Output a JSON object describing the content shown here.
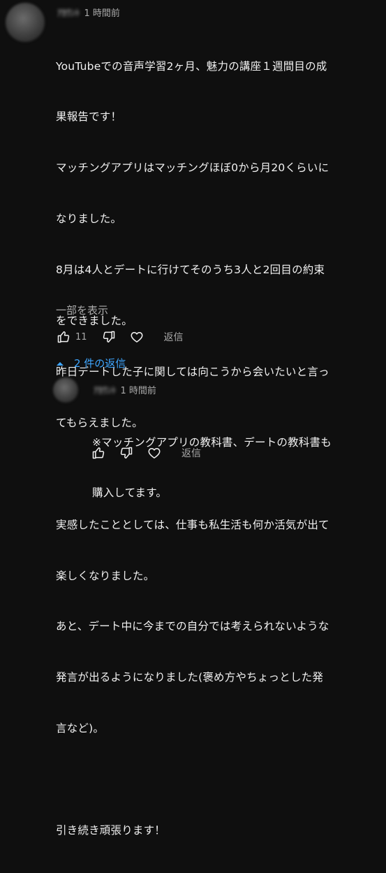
{
  "comment": {
    "author": "ｱｶｳﾝﾄ",
    "time": "1 時間前",
    "lines": [
      "YouTubeでの音声学習2ヶ月、魅力の講座１週間目の成",
      "果報告です！",
      "マッチングアプリはマッチングほぼ0から月20くらいに",
      "なりました。",
      "8月は4人とデートに行けてそのうち3人と2回目の約束",
      "をできました。",
      "昨日デートした子に関しては向こうから会いたいと言っ",
      "てもらえました。",
      "",
      "実感したこととしては、仕事も私生活も何か活気が出て",
      "楽しくなりました。",
      "あと、デート中に今までの自分では考えられないような",
      "発言が出るようになりました(褒め方やちょっとした発",
      "言など)。",
      "",
      "引き続き頑張ります！"
    ],
    "show_more": "一部を表示",
    "like_count": "11",
    "reply_label": "返信"
  },
  "replies_toggle": "2 件の返信",
  "reply": {
    "author": "ｱｶｳﾝﾄ",
    "time": "1 時間前",
    "lines": [
      "※マッチングアプリの教科書、デートの教科書も",
      "購入してます。"
    ],
    "reply_label": "返信"
  },
  "colors": {
    "background": "#0f0f0f",
    "text": "#f1f1f1",
    "muted": "#aaaaaa",
    "link": "#3ea6ff"
  }
}
